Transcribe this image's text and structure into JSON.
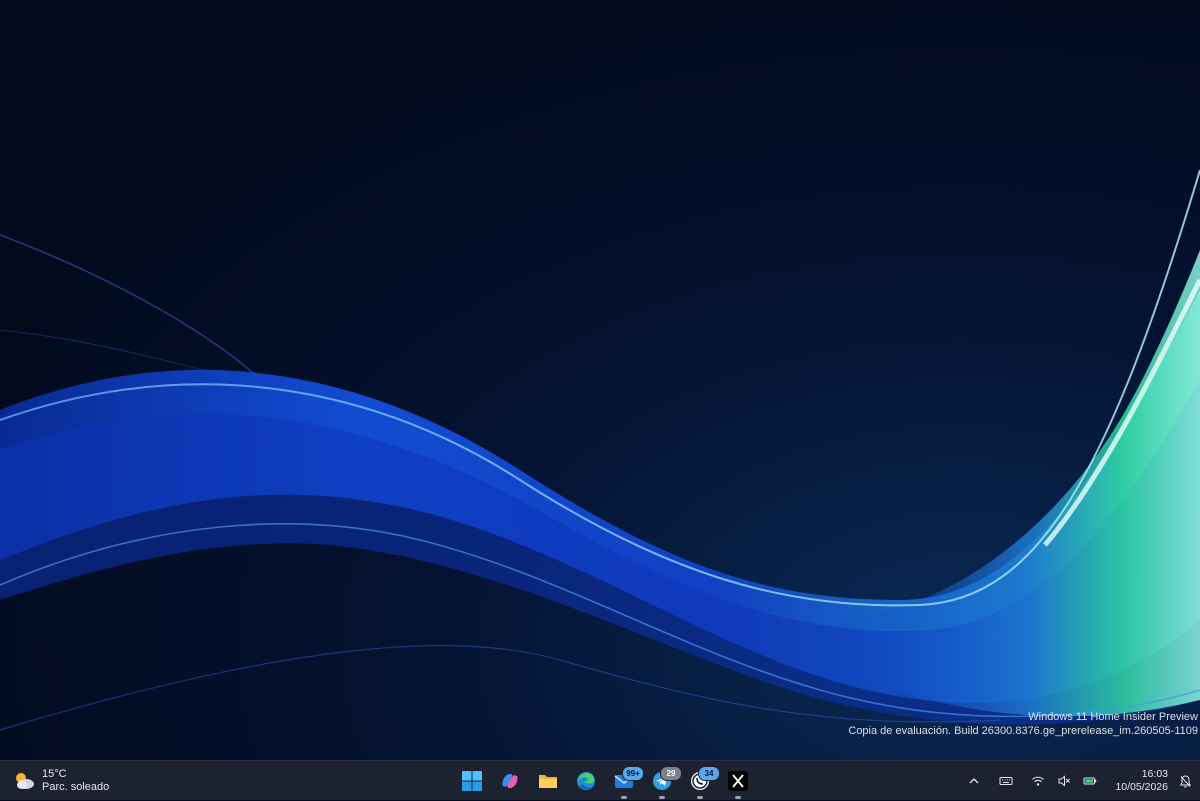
{
  "desktop": {
    "watermark": {
      "line1": "Windows 11 Home Insider Preview",
      "line2": "Copia de evaluación. Build 26300.8376.ge_prerelease_im.260505-1109"
    },
    "wallpaper_colors": [
      "#020a1c",
      "#0b3fd8",
      "#3aa0ff",
      "#2fd6a0"
    ]
  },
  "taskbar": {
    "weather": {
      "temp": "15°C",
      "condition": "Parc. soleado",
      "icon": "partly-sunny-icon"
    },
    "apps": [
      {
        "name": "start",
        "icon": "windows-logo-icon"
      },
      {
        "name": "copilot",
        "icon": "copilot-icon"
      },
      {
        "name": "file-explorer",
        "icon": "folder-icon"
      },
      {
        "name": "edge",
        "icon": "edge-icon"
      },
      {
        "name": "mail",
        "icon": "mail-icon",
        "badge": "99+",
        "running": true
      },
      {
        "name": "telegram",
        "icon": "telegram-icon",
        "badge": "29",
        "running": true
      },
      {
        "name": "whatsapp",
        "icon": "whatsapp-icon",
        "badge": "34",
        "running": true
      },
      {
        "name": "x",
        "icon": "x-icon",
        "running": true
      }
    ],
    "tray": {
      "icons": [
        "chevron-up-icon",
        "keyboard-icon",
        "wifi-icon",
        "volume-muted-icon",
        "battery-icon",
        "notification-bell-icon"
      ],
      "time": "16:03",
      "date": "10/05/2026"
    },
    "background": "#1c2230"
  }
}
